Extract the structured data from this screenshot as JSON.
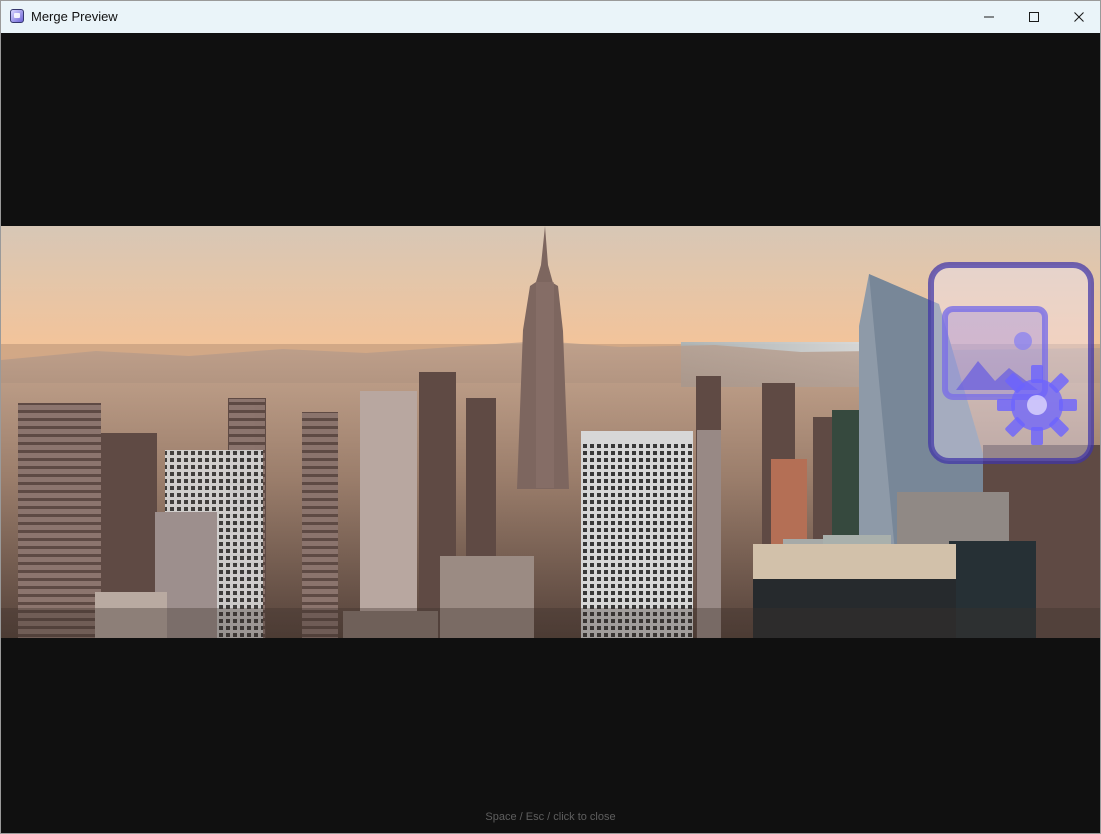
{
  "window": {
    "title": "Merge Preview",
    "app_icon": "image-settings-icon",
    "controls": [
      {
        "name": "minimize",
        "icon": "minimize-icon"
      },
      {
        "name": "maximize",
        "icon": "maximize-icon"
      },
      {
        "name": "close",
        "icon": "close-icon"
      }
    ]
  },
  "preview": {
    "image_subject": "city-skyline-photo",
    "overlay_icon": "image-settings-icon",
    "hint": "Space / Esc / click to close"
  },
  "colors": {
    "titlebar": "#eaf4f9",
    "background": "#101010",
    "hint_text": "#5f5f5f",
    "overlay_accent": "#6c63ff"
  }
}
